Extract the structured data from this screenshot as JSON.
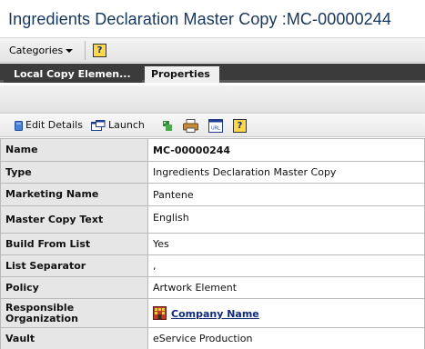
{
  "title": "Ingredients Declaration Master Copy :MC-00000244",
  "menubar": {
    "categories_label": "Categories",
    "help_label": "?"
  },
  "tabs": [
    {
      "label": "Local Copy Elemen...",
      "active": false
    },
    {
      "label": "Properties",
      "active": true
    }
  ],
  "toolbar": {
    "edit_details_label": "Edit Details",
    "launch_label": "Launch",
    "help_label": "?",
    "icons": [
      "edit-icon",
      "launch-icon",
      "bookmark-icon",
      "print-icon",
      "url-icon",
      "help-icon"
    ]
  },
  "properties": [
    {
      "key": "Name",
      "value": "MC-00000244"
    },
    {
      "key": "Type",
      "value": "Ingredients Declaration Master Copy"
    },
    {
      "key": "Marketing Name",
      "value": "Pantene"
    },
    {
      "key": "Master Copy Text",
      "value": "English"
    },
    {
      "key": "Build From List",
      "value": "Yes"
    },
    {
      "key": "List Separator",
      "value": ","
    },
    {
      "key": "Policy",
      "value": "Artwork Element"
    },
    {
      "key": "Responsible Organization",
      "value": "Company Name"
    },
    {
      "key": "Vault",
      "value": "eService Production"
    }
  ],
  "colors": {
    "title": "#17365c",
    "tab_bar": "#3b3b3b",
    "key_cell": "#e6e6e6",
    "link": "#0f2a7a"
  }
}
